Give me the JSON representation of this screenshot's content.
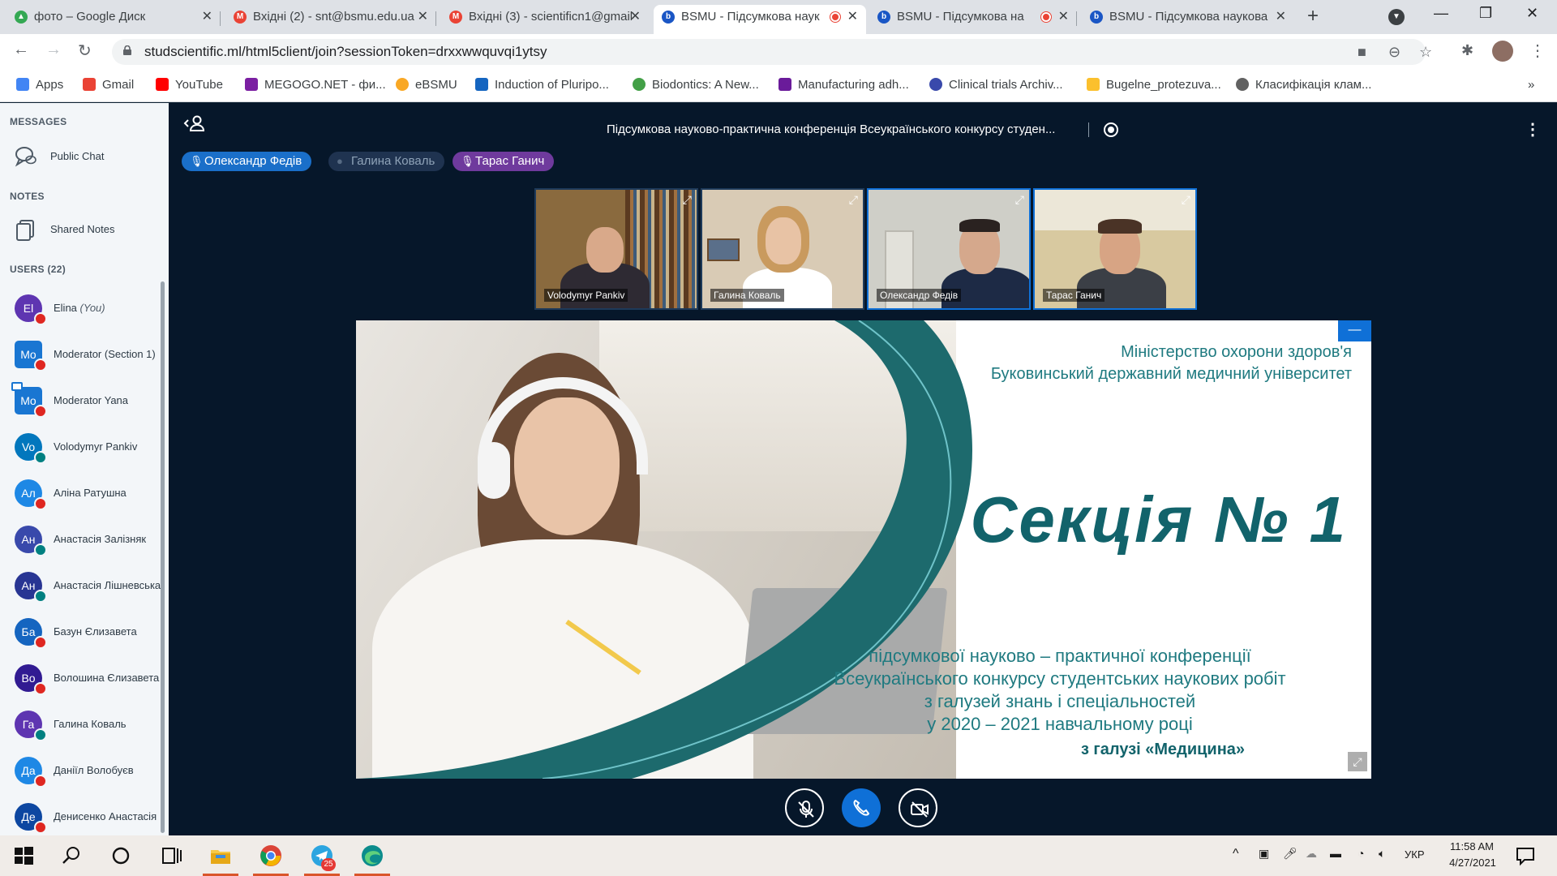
{
  "browser": {
    "tabs": [
      {
        "title": "фото – Google Диск",
        "favicon_color": "#34a853",
        "active": false
      },
      {
        "title": "Вхідні (2) - snt@bsmu.edu.ua",
        "favicon_color": "#ea4335",
        "active": false
      },
      {
        "title": "Вхідні (3) - scientificn1@gmail",
        "favicon_color": "#ea4335",
        "active": false
      },
      {
        "title": "BSMU - Підсумкова наук",
        "favicon_color": "#1a56c5",
        "active": true,
        "recording": true
      },
      {
        "title": "BSMU - Підсумкова на",
        "favicon_color": "#1a56c5",
        "active": false,
        "recording": true
      },
      {
        "title": "BSMU - Підсумкова наукова",
        "favicon_color": "#1a56c5",
        "active": false
      }
    ],
    "url": "studscientific.ml/html5client/join?sessionToken=drxxwwquvqi1ytsy",
    "bookmarks": [
      {
        "label": "Apps",
        "color": "#4285f4"
      },
      {
        "label": "Gmail",
        "color": "#ea4335"
      },
      {
        "label": "YouTube",
        "color": "#ff0000"
      },
      {
        "label": "MEGOGO.NET - фи...",
        "color": "#7b1fa2"
      },
      {
        "label": "eBSMU",
        "color": "#f9a825"
      },
      {
        "label": "Induction of Pluripo...",
        "color": "#1565c0"
      },
      {
        "label": "Biodontics: A New...",
        "color": "#43a047"
      },
      {
        "label": "Manufacturing adh...",
        "color": "#6a1b9a"
      },
      {
        "label": "Clinical trials Archiv...",
        "color": "#3949ab"
      },
      {
        "label": "Bugelne_protezuva...",
        "color": "#fbc02d"
      },
      {
        "label": "Класифікація клам...",
        "color": "#616161"
      }
    ]
  },
  "sidebar": {
    "messages_heading": "MESSAGES",
    "public_chat": "Public Chat",
    "notes_heading": "NOTES",
    "shared_notes": "Shared Notes",
    "users_heading": "USERS (22)",
    "users": [
      {
        "initials": "El",
        "name": "Elina",
        "suffix": "(You)",
        "color": "#5e35b1",
        "mod": false,
        "badge": "muted"
      },
      {
        "initials": "Mo",
        "name": "Moderator (Section 1)",
        "suffix": "",
        "color": "#1976d2",
        "mod": true,
        "badge": "muted"
      },
      {
        "initials": "Mo",
        "name": "Moderator Yana",
        "suffix": "",
        "color": "#1976d2",
        "mod": true,
        "badge": "muted",
        "presenter": true
      },
      {
        "initials": "Vo",
        "name": "Volodymyr Pankiv",
        "suffix": "",
        "color": "#0277bd",
        "mod": false,
        "badge": "listen"
      },
      {
        "initials": "Ал",
        "name": "Аліна Ратушна",
        "suffix": "",
        "color": "#1e88e5",
        "mod": false,
        "badge": "muted"
      },
      {
        "initials": "Ан",
        "name": "Анастасія Залізняк",
        "suffix": "",
        "color": "#3949ab",
        "mod": false,
        "badge": "listen"
      },
      {
        "initials": "Ан",
        "name": "Анастасія Лішневська",
        "suffix": "",
        "color": "#283593",
        "mod": false,
        "badge": "listen"
      },
      {
        "initials": "Ба",
        "name": "Базун Єлизавета",
        "suffix": "",
        "color": "#1565c0",
        "mod": false,
        "badge": "muted"
      },
      {
        "initials": "Во",
        "name": "Волошина Єлизавета",
        "suffix": "",
        "color": "#311b92",
        "mod": false,
        "badge": "muted"
      },
      {
        "initials": "Га",
        "name": "Галина Коваль",
        "suffix": "",
        "color": "#5e35b1",
        "mod": false,
        "badge": "listen"
      },
      {
        "initials": "Да",
        "name": "Даніїл Волобуєв",
        "suffix": "",
        "color": "#1e88e5",
        "mod": false,
        "badge": "muted"
      },
      {
        "initials": "Де",
        "name": "Денисенко Анастасія",
        "suffix": "",
        "color": "#0d47a1",
        "mod": false,
        "badge": "muted"
      }
    ]
  },
  "meeting": {
    "title": "Підсумкова науково-практична конференція Всеукраїнського конкурсу студен...",
    "talkers": [
      {
        "name": "Олександр Федів",
        "color": "#1a6fc9",
        "active": true
      },
      {
        "name": "Галина Коваль",
        "color": "#1f3350",
        "active": false
      },
      {
        "name": "Тарас Ганич",
        "color": "#6f3a9d",
        "active": true
      }
    ],
    "videos": [
      {
        "name": "Volodymyr Pankiv",
        "bg": "#8a6a3e",
        "skin": "#d9a98a",
        "suit": "#2e2a33"
      },
      {
        "name": "Галина Коваль",
        "bg": "#d9cbb5",
        "skin": "#e8c3a5",
        "suit": "#ffffff"
      },
      {
        "name": "Олександр Федів",
        "bg": "#cfcfc8",
        "skin": "#d5a88c",
        "suit": "#1d2a45"
      },
      {
        "name": "Тарас Ганич",
        "bg": "#d8c9a0",
        "skin": "#d7a484",
        "suit": "#3b3f46"
      }
    ],
    "slide": {
      "ministry_line1": "Міністерство охорони здоров'я",
      "ministry_line2": "Буковинський державний медичний університет",
      "section": "Секція № 1",
      "sub1": "підсумкової науково – практичної конференції",
      "sub2": "Всеукраїнського конкурсу студентських наукових робіт",
      "sub3": "з галузей знань і спеціальностей",
      "sub4": "у 2020 – 2021 навчальному році",
      "field": "з галузі «Медицина»",
      "accent": "#12636b"
    }
  },
  "taskbar": {
    "language": "УКР",
    "time": "11:58 AM",
    "date": "4/27/2021",
    "telegram_badge": "25"
  }
}
